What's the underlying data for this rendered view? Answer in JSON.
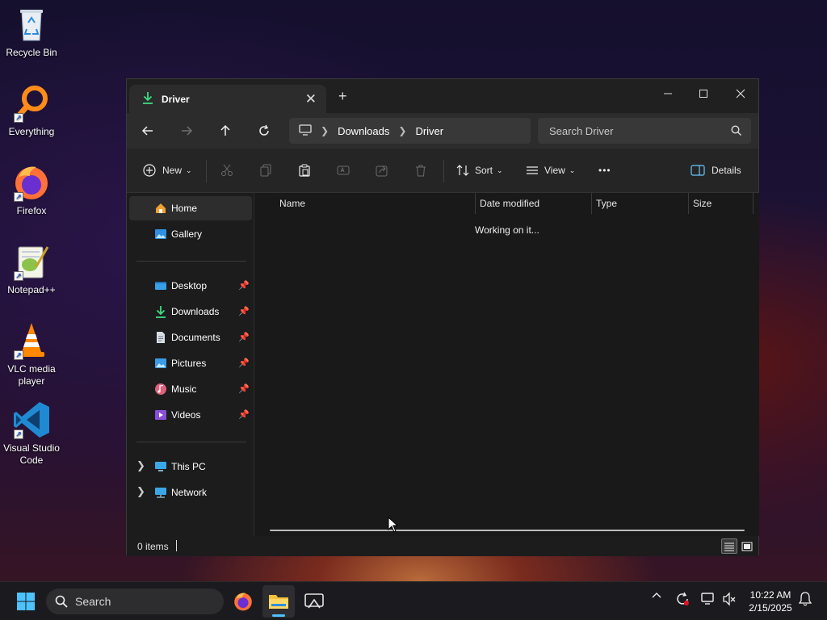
{
  "desktop": {
    "icons": [
      {
        "label": "Recycle Bin"
      },
      {
        "label": "Everything"
      },
      {
        "label": "Firefox"
      },
      {
        "label": "Notepad++"
      },
      {
        "label": "VLC media player"
      },
      {
        "label": "Visual Studio Code"
      }
    ]
  },
  "window": {
    "tab_title": "Driver",
    "breadcrumb": [
      "Downloads",
      "Driver"
    ],
    "search_placeholder": "Search Driver",
    "toolbar": {
      "new_label": "New",
      "sort_label": "Sort",
      "view_label": "View",
      "more_label": "•••",
      "details_label": "Details"
    },
    "nav": {
      "home": "Home",
      "gallery": "Gallery",
      "pinned": [
        "Desktop",
        "Downloads",
        "Documents",
        "Pictures",
        "Music",
        "Videos"
      ],
      "this_pc": "This PC",
      "network": "Network"
    },
    "columns": [
      "Name",
      "Date modified",
      "Type",
      "Size"
    ],
    "loading_text": "Working on it...",
    "status_text": "0 items"
  },
  "taskbar": {
    "search_label": "Search",
    "time": "10:22 AM",
    "date": "2/15/2025"
  },
  "colors": {
    "accent": "#4cc2ff",
    "window_bg": "#191919",
    "titlebar_bg": "#202020",
    "addressbar_bg": "#2c2c2c"
  }
}
